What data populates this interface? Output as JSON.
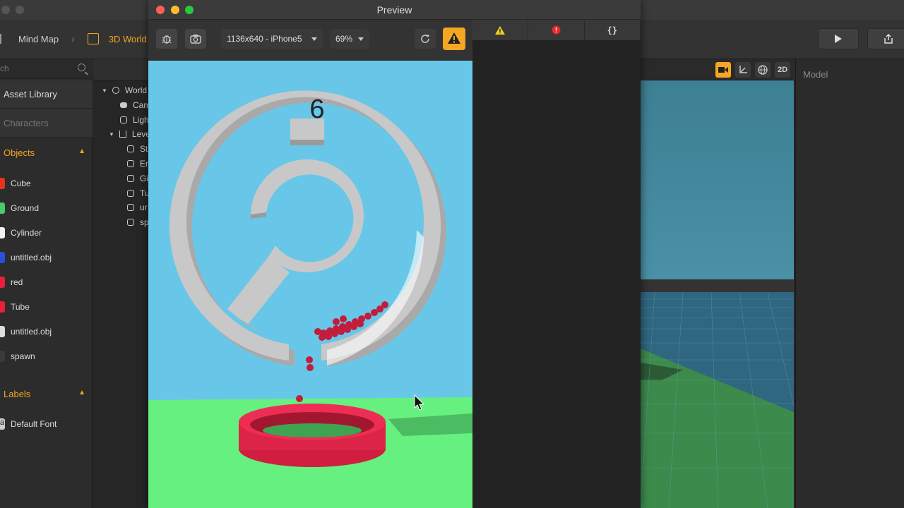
{
  "breadcrumb": {
    "items": [
      "Mind Map",
      "3D World"
    ]
  },
  "sidebar": {
    "search_placeholder": "ch",
    "sections": [
      "Asset Library",
      "Characters"
    ],
    "objects_header": "Objects",
    "objects": [
      {
        "label": "Cube",
        "color": "#e8321e"
      },
      {
        "label": "Ground",
        "color": "#4cc96a"
      },
      {
        "label": "Cylinder",
        "color": "#f2f2f2"
      },
      {
        "label": "untitled.obj",
        "color": "#2b4fd8"
      },
      {
        "label": "red",
        "color": "#e8203c"
      },
      {
        "label": "Tube",
        "color": "#e8203c"
      },
      {
        "label": "untitled.obj",
        "color": "#dddddd"
      },
      {
        "label": "spawn",
        "color": "#3a3a3a"
      }
    ],
    "labels_header": "Labels",
    "labels": [
      {
        "label": "Default Font",
        "icon": "a"
      }
    ]
  },
  "tree": {
    "items": [
      "World",
      "Cam",
      "Ligh",
      "Leve",
      "St",
      "Er",
      "Gi",
      "Tu",
      "ur",
      "sp"
    ]
  },
  "preview": {
    "title": "Preview",
    "resolution": "1136x640 - iPhone5",
    "zoom": "69%",
    "score": "6",
    "console_tabs": [
      "warning-icon",
      "error-icon",
      "json-icon"
    ],
    "json_label": "{}"
  },
  "right_panel": {
    "label": "Model"
  },
  "viewport_toolbar": {
    "mode_2d": "2D"
  }
}
